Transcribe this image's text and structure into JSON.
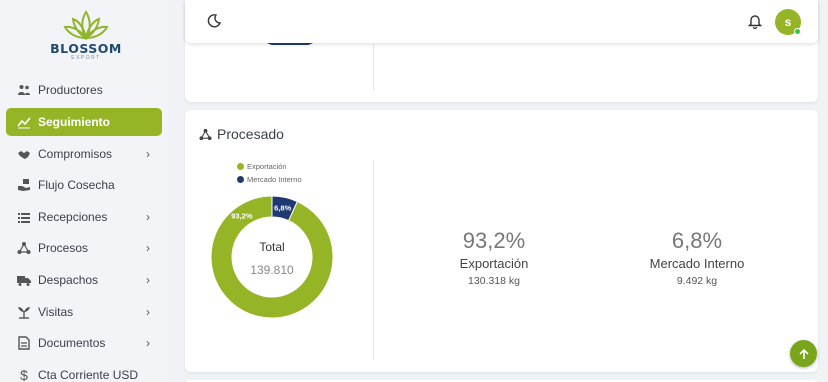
{
  "brand": {
    "name": "BLOSSOM",
    "subtitle": "EXPORT"
  },
  "sidebar": {
    "items": [
      {
        "label": "Productores",
        "icon": "people-icon",
        "chevron": false,
        "active": false
      },
      {
        "label": "Seguimiento",
        "icon": "chart-line-icon",
        "chevron": false,
        "active": true
      },
      {
        "label": "Compromisos",
        "icon": "handshake-icon",
        "chevron": true,
        "active": false
      },
      {
        "label": "Flujo Cosecha",
        "icon": "hand-box-icon",
        "chevron": false,
        "active": false
      },
      {
        "label": "Recepciones",
        "icon": "list-icon",
        "chevron": true,
        "active": false
      },
      {
        "label": "Procesos",
        "icon": "network-icon",
        "chevron": true,
        "active": false
      },
      {
        "label": "Despachos",
        "icon": "truck-icon",
        "chevron": true,
        "active": false
      },
      {
        "label": "Visitas",
        "icon": "plant-icon",
        "chevron": true,
        "active": false
      },
      {
        "label": "Documentos",
        "icon": "document-icon",
        "chevron": true,
        "active": false
      },
      {
        "label": "Cta Corriente USD",
        "icon": "dollar-icon",
        "chevron": false,
        "active": false
      }
    ]
  },
  "topbar": {
    "avatar_initial": "s"
  },
  "procesado": {
    "title": "Procesado",
    "legend": [
      "Exportación",
      "Mercado Interno"
    ],
    "center_label": "Total",
    "center_value": "139.810",
    "stats": [
      {
        "pct": "93,2%",
        "label": "Exportación",
        "kg": "130.318 kg"
      },
      {
        "pct": "6,8%",
        "label": "Mercado Interno",
        "kg": "9.492 kg"
      }
    ]
  },
  "colors": {
    "accent": "#95b526",
    "export": "#95b526",
    "internal": "#1f3a73"
  },
  "chart_data": {
    "type": "pie",
    "categories": [
      "Exportación",
      "Mercado Interno"
    ],
    "values": [
      93.2,
      6.8
    ],
    "data_labels": [
      "93,2%",
      "6,8%"
    ],
    "title": "",
    "legend": "top"
  }
}
